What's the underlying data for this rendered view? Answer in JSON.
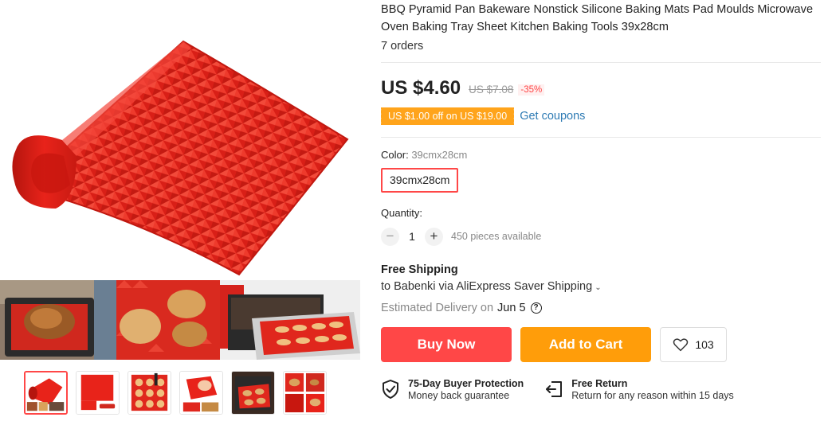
{
  "product": {
    "title": "BBQ Pyramid Pan Bakeware Nonstick Silicone Baking Mats Pad Moulds Microwave Oven Baking Tray Sheet Kitchen Baking Tools 39x28cm",
    "orders": "7 orders",
    "price": "US $4.60",
    "original_price": "US $7.08",
    "discount": "-35%"
  },
  "coupon": {
    "badge": "US $1.00 off on US $19.00",
    "link": "Get coupons"
  },
  "sku": {
    "color_label": "Color:",
    "color_value": "39cmx28cm",
    "selected_option": "39cmx28cm"
  },
  "quantity": {
    "label": "Quantity:",
    "minus": "−",
    "value": "1",
    "plus": "+",
    "available": "450 pieces available"
  },
  "shipping": {
    "title": "Free Shipping",
    "line": "to Babenki via AliExpress Saver Shipping",
    "chevron": "⌄",
    "delivery_prefix": "Estimated Delivery on",
    "delivery_date": "Jun 5",
    "help": "?"
  },
  "actions": {
    "buy_now": "Buy Now",
    "add_to_cart": "Add to Cart",
    "wishlist_count": "103"
  },
  "guarantees": [
    {
      "title": "75-Day Buyer Protection",
      "subtitle": "Money back guarantee",
      "icon": "shield-check-icon"
    },
    {
      "title": "Free Return",
      "subtitle": "Return for any reason within 15 days",
      "icon": "return-icon"
    }
  ],
  "colors": {
    "accent_red": "#ff4747",
    "accent_orange": "#ff9d0a",
    "coupon_orange": "#ffa41b",
    "link_blue": "#2e7bb4",
    "product_red": "#e8231a"
  },
  "gallery": {
    "thumbnail_count": 6,
    "active_thumbnail": 1
  }
}
